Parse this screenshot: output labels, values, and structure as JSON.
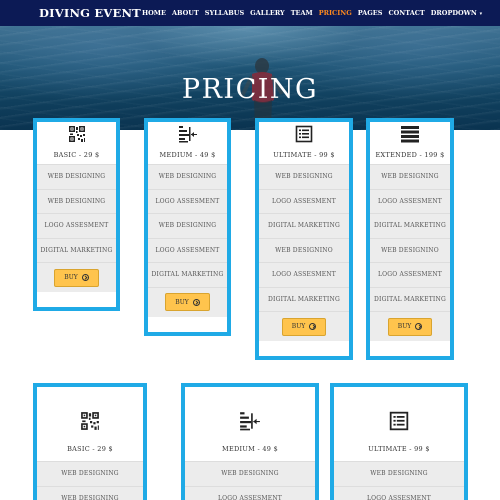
{
  "nav": {
    "logo": "DIVING EVENT",
    "items": [
      {
        "label": "HOME",
        "active": false
      },
      {
        "label": "ABOUT",
        "active": false
      },
      {
        "label": "SYLLABUS",
        "active": false
      },
      {
        "label": "GALLERY",
        "active": false
      },
      {
        "label": "TEAM",
        "active": false
      },
      {
        "label": "PRICING",
        "active": true
      },
      {
        "label": "PAGES",
        "active": false
      },
      {
        "label": "CONTACT",
        "active": false
      },
      {
        "label": "DROPDOWN",
        "active": false,
        "has_caret": true
      }
    ],
    "active_color": "#ff8a1e"
  },
  "hero": {
    "title": "PRICING"
  },
  "accent_color": "#1faae6",
  "button_color": "#ffc44d",
  "plans_row1": [
    {
      "icon": "qr-code-icon",
      "title": "BASIC - 29 $",
      "features": [
        "WEB DESIGNING",
        "WEB DESIGNING",
        "LOGO ASSESMENT",
        "DIGITAL MARKETING"
      ],
      "button": "BUY"
    },
    {
      "icon": "align-arrow-icon",
      "title": "MEDIUM - 49 $",
      "features": [
        "WEB DESIGNING",
        "LOGO ASSESMENT",
        "WEB DESIGNING",
        "LOGO ASSESMENT",
        "DIGITAL MARKETING"
      ],
      "button": "BUY"
    },
    {
      "icon": "list-alt-icon",
      "title": "ULTIMATE - 99 $",
      "features": [
        "WEB DESIGNING",
        "LOGO ASSESMENT",
        "DIGITAL MARKETING",
        "WEB DESIGNINO",
        "LOGO ASSESMENT",
        "DIGITAL MARKETING"
      ],
      "button": "BUY"
    },
    {
      "icon": "bars-icon",
      "title": "EXTENDED - 199 $",
      "features": [
        "WEB DESIGNING",
        "LOGO ASSESMENT",
        "DIGITAL MARKETING",
        "WEB DESIGNINO",
        "LOGO ASSESMENT",
        "DIGITAL MARKETING"
      ],
      "button": "BUY"
    }
  ],
  "plans_row2": [
    {
      "icon": "qr-code-icon",
      "title": "BASIC - 29 $",
      "features": [
        "WEB DESIGNING",
        "WEB DESIGNING"
      ]
    },
    {
      "icon": "align-arrow-icon",
      "title": "MEDIUM - 49 $",
      "features": [
        "WEB DESIGNING",
        "LOGO ASSESMENT"
      ]
    },
    {
      "icon": "list-alt-icon",
      "title": "ULTIMATE - 99 $",
      "features": [
        "WEB DESIGNING",
        "LOGO ASSESMENT"
      ]
    }
  ]
}
